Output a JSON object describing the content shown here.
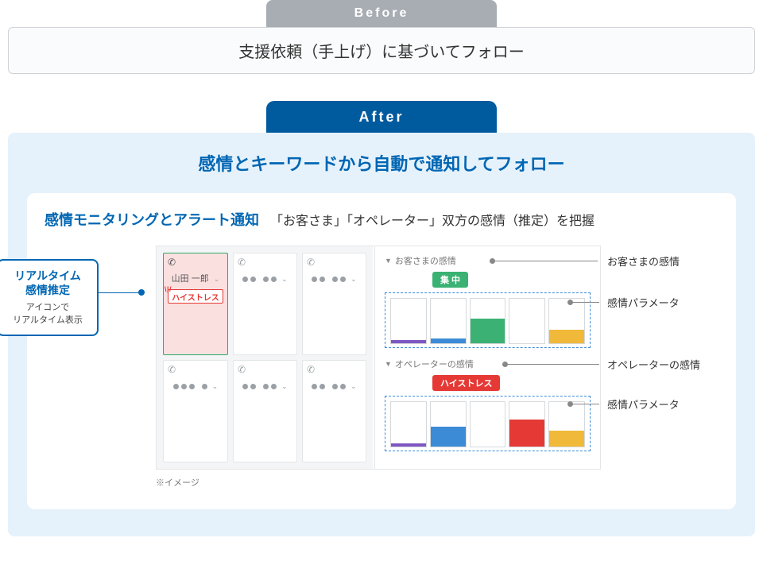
{
  "before": {
    "tab": "Before",
    "text": "支援依頼（手上げ）に基づいてフォロー"
  },
  "after": {
    "tab": "After",
    "title": "感情とキーワードから自動で通知してフォロー",
    "panel_lead": "感情モニタリングとアラート通知",
    "panel_sub": "「お客さま」「オペレーター」双方の感情（推定）を把握",
    "note": "※イメージ"
  },
  "callout_left": {
    "title1": "リアルタイム",
    "title2": "感情推定",
    "sub1": "アイコンで",
    "sub2": "リアルタイム表示"
  },
  "grid": {
    "active_name": "山田 一郎",
    "badge": "ハイストレス"
  },
  "right": {
    "customer_head": "お客さまの感情",
    "customer_pill": "集 中",
    "operator_head": "オペレーターの感情",
    "operator_pill": "ハイストレス"
  },
  "callouts_right": {
    "c1": "お客さまの感情",
    "c2": "感情パラメータ",
    "c3": "オペレーターの感情",
    "c4": "感情パラメータ"
  },
  "chart_data": [
    {
      "type": "bar",
      "title": "お客さまの感情",
      "series": [
        {
          "name": "customer",
          "values": [
            8,
            10,
            55,
            5,
            30
          ]
        }
      ],
      "colors": [
        "#7e57c2",
        "#3b8bd6",
        "#3bb273",
        "#ffffff",
        "#f0b93a"
      ],
      "ylim": [
        0,
        100
      ]
    },
    {
      "type": "bar",
      "title": "オペレーターの感情",
      "series": [
        {
          "name": "operator",
          "values": [
            8,
            45,
            5,
            60,
            35
          ]
        }
      ],
      "colors": [
        "#7e57c2",
        "#3b8bd6",
        "#ffffff",
        "#e53935",
        "#f0b93a"
      ],
      "ylim": [
        0,
        100
      ]
    }
  ]
}
